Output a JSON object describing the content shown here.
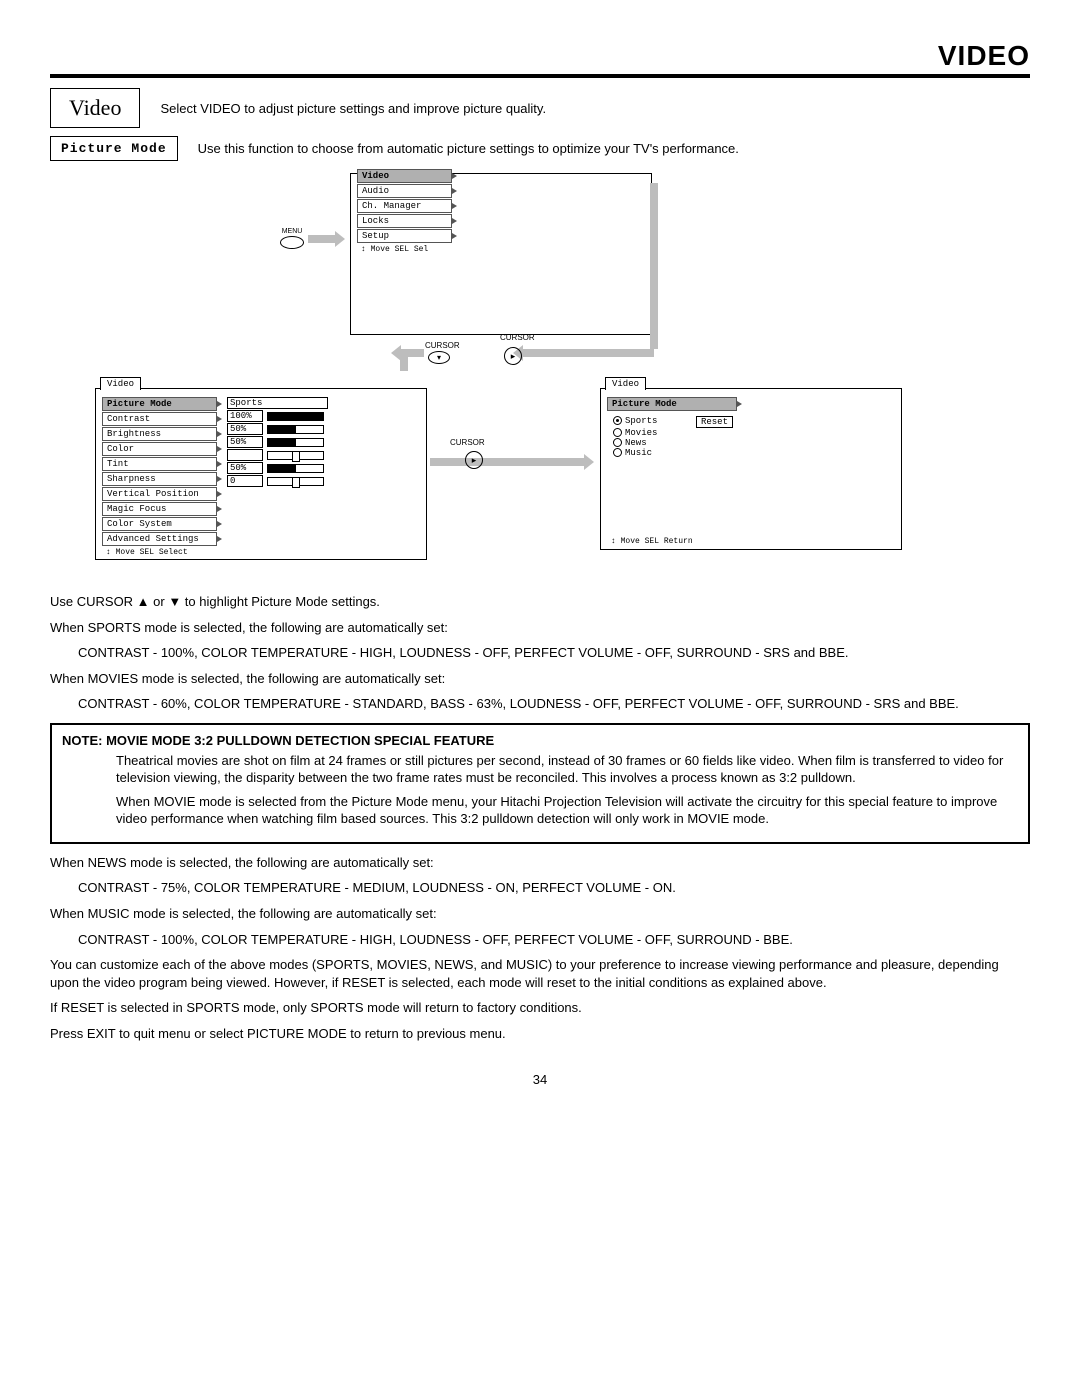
{
  "header": {
    "title": "VIDEO"
  },
  "video_row": {
    "box": "Video",
    "desc": "Select VIDEO to adjust picture settings and improve picture quality."
  },
  "pm_row": {
    "box": "Picture Mode",
    "desc": "Use this function to choose from automatic picture settings to optimize your TV's performance."
  },
  "diagram": {
    "menu_label": "MENU",
    "cursor_label": "CURSOR",
    "main_menu": {
      "items": [
        "Video",
        "Audio",
        "Ch. Manager",
        "Locks",
        "Setup"
      ],
      "selected": "Video",
      "footer": "Move  SEL  Sel"
    },
    "video_menu": {
      "tab": "Video",
      "items": [
        "Picture Mode",
        "Contrast",
        "Brightness",
        "Color",
        "Tint",
        "Sharpness",
        "Vertical Position",
        "Magic Focus",
        "Color System",
        "Advanced Settings"
      ],
      "selected": "Picture Mode",
      "values": {
        "Picture Mode": "Sports",
        "Contrast": "100%",
        "Brightness": "50%",
        "Color": "50%",
        "Tint": "",
        "Sharpness": "50%",
        "Vertical Position": "0"
      },
      "footer": "Move  SEL  Select"
    },
    "pm_menu": {
      "tab": "Video",
      "subtab": "Picture Mode",
      "options": [
        "Sports",
        "Movies",
        "News",
        "Music"
      ],
      "selected": "Sports",
      "reset": "Reset",
      "footer": "Move  SEL  Return"
    }
  },
  "body": {
    "p1": "Use CURSOR ▲ or ▼ to highlight Picture Mode settings.",
    "p2": "When SPORTS mode is selected, the following are automatically set:",
    "p2b": "CONTRAST - 100%, COLOR TEMPERATURE - HIGH, LOUDNESS - OFF, PERFECT VOLUME - OFF, SURROUND - SRS and BBE.",
    "p3": "When MOVIES mode is selected, the following are automatically set:",
    "p3b": "CONTRAST - 60%, COLOR TEMPERATURE - STANDARD, BASS - 63%, LOUDNESS - OFF, PERFECT VOLUME - OFF, SURROUND - SRS and BBE.",
    "note": {
      "label": "NOTE:",
      "title": "MOVIE MODE 3:2 PULLDOWN DETECTION SPECIAL FEATURE",
      "p1": "Theatrical movies are shot on film at 24 frames or still pictures per second, instead of 30 frames or 60 fields like video. When film is transferred to video for television viewing, the disparity between the two frame rates must be reconciled. This involves a process known as 3:2 pulldown.",
      "p2": "When MOVIE mode is selected from the Picture Mode menu, your Hitachi Projection Television will activate the circuitry for this special feature to improve video performance when watching film based sources. This 3:2 pulldown detection will only work in MOVIE mode."
    },
    "p4": "When NEWS mode is selected, the following are automatically set:",
    "p4b": "CONTRAST - 75%, COLOR TEMPERATURE - MEDIUM, LOUDNESS - ON, PERFECT VOLUME - ON.",
    "p5": "When MUSIC mode is selected, the following are automatically set:",
    "p5b": "CONTRAST - 100%, COLOR TEMPERATURE - HIGH, LOUDNESS - OFF, PERFECT VOLUME - OFF, SURROUND - BBE.",
    "p6": "You can customize each of the above modes (SPORTS, MOVIES, NEWS, and MUSIC) to your preference to increase viewing performance and pleasure, depending upon the video program being viewed. However, if RESET is selected, each mode will reset to the initial conditions as explained above.",
    "p7": "If RESET is selected in SPORTS mode, only SPORTS mode will return to factory conditions.",
    "p8": "Press EXIT to quit menu or select PICTURE MODE to return to previous menu."
  },
  "page": "34"
}
